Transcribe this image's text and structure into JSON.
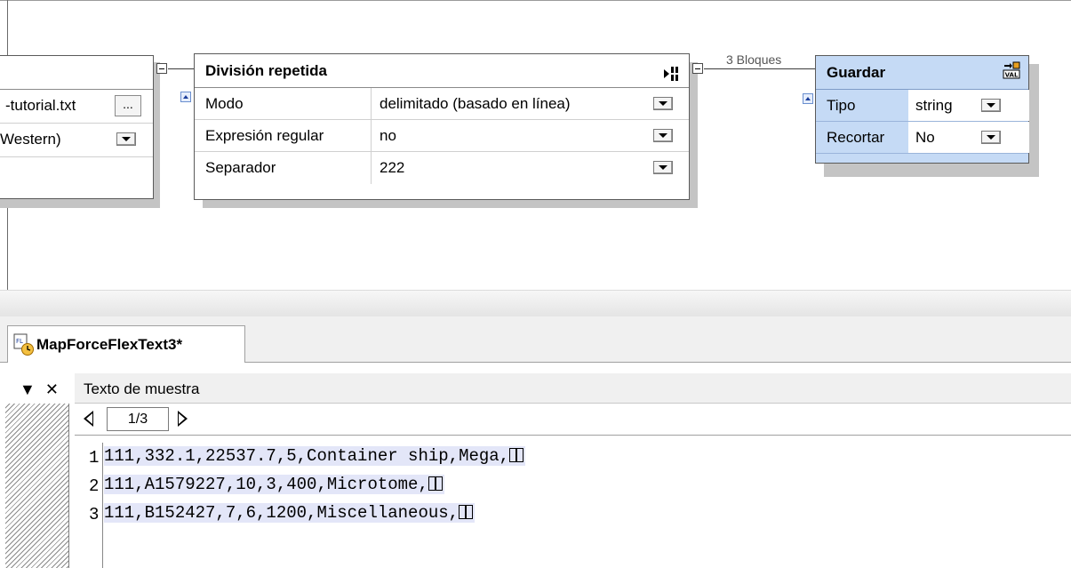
{
  "source_box": {
    "file_value": "-tutorial.txt",
    "browse_label": "...",
    "encoding_value": "Western)"
  },
  "split_box": {
    "title": "División repetida",
    "rows": [
      {
        "label": "Modo",
        "value": "delimitado (basado en línea)"
      },
      {
        "label": "Expresión regular",
        "value": "no"
      },
      {
        "label": "Separador",
        "value": "222"
      }
    ]
  },
  "connector_label": "3 Bloques",
  "store_box": {
    "title": "Guardar",
    "rows": [
      {
        "label": "Tipo",
        "value": "string"
      },
      {
        "label": "Recortar",
        "value": "No"
      }
    ]
  },
  "document_tab": {
    "label": "MapForceFlexText3*"
  },
  "sample_panel": {
    "title": "Texto de muestra",
    "page_indicator": "1/3"
  },
  "sample_lines": [
    {
      "number": "1",
      "text": "111,332.1,22537.7,5,Container ship,Mega,"
    },
    {
      "number": "2",
      "text": "111,A1579227,10,3,400,Microtome,"
    },
    {
      "number": "3",
      "text": "111,B152427,7,6,1200,Miscellaneous,"
    }
  ],
  "icons": {
    "split": "split-block-icon",
    "store": "store-value-icon",
    "tab": "flextext-file-icon",
    "line_end": "crlf-icon"
  },
  "colors": {
    "store_box_bg": "#c5daf5",
    "sample_highlight": "#e3e6f8"
  }
}
